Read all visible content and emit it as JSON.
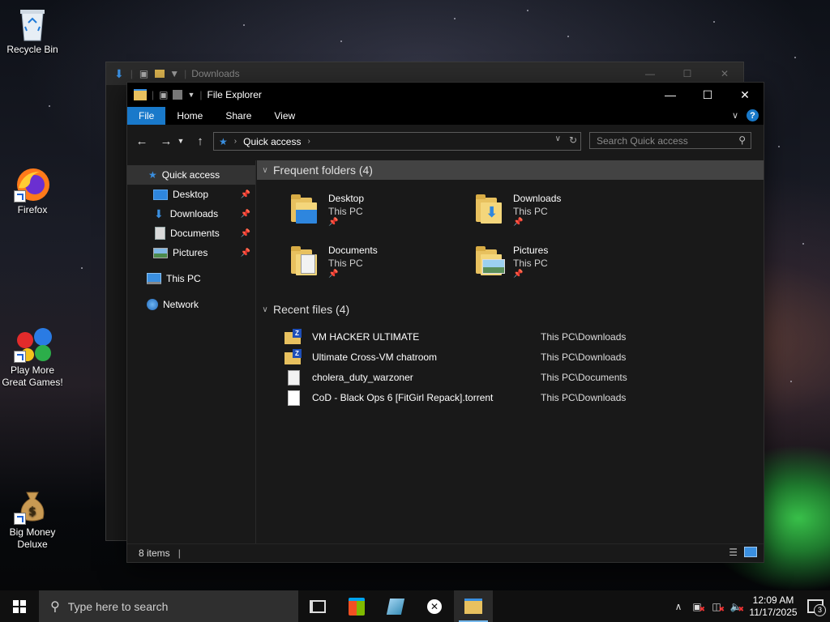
{
  "desktop": {
    "icons": [
      {
        "label": "Recycle Bin"
      },
      {
        "label": "Firefox"
      },
      {
        "label": "Play More Great Games!"
      },
      {
        "label": "Big Money Deluxe"
      }
    ]
  },
  "back_window": {
    "title": "Downloads"
  },
  "window": {
    "title": "File Explorer",
    "ribbon_tabs": [
      "File",
      "Home",
      "Share",
      "View"
    ],
    "address": {
      "crumb": "Quick access"
    },
    "search_placeholder": "Search Quick access",
    "nav": {
      "quick_access": "Quick access",
      "pinned": [
        {
          "label": "Desktop"
        },
        {
          "label": "Downloads"
        },
        {
          "label": "Documents"
        },
        {
          "label": "Pictures"
        }
      ],
      "this_pc": "This PC",
      "network": "Network"
    },
    "frequent": {
      "header": "Frequent folders (4)",
      "items": [
        {
          "name": "Desktop",
          "location": "This PC"
        },
        {
          "name": "Downloads",
          "location": "This PC"
        },
        {
          "name": "Documents",
          "location": "This PC"
        },
        {
          "name": "Pictures",
          "location": "This PC"
        }
      ]
    },
    "recent": {
      "header": "Recent files (4)",
      "items": [
        {
          "name": "VM HACKER ULTIMATE",
          "path": "This PC\\Downloads",
          "icon": "zip-folder-icon"
        },
        {
          "name": "Ultimate Cross-VM chatroom",
          "path": "This PC\\Downloads",
          "icon": "zip-folder-icon"
        },
        {
          "name": "cholera_duty_warzoner",
          "path": "This PC\\Documents",
          "icon": "text-file-icon"
        },
        {
          "name": "CoD - Black Ops 6 [FitGirl Repack].torrent",
          "path": "This PC\\Downloads",
          "icon": "blank-file-icon"
        }
      ]
    },
    "status": "8 items"
  },
  "taskbar": {
    "search_placeholder": "Type here to search",
    "time": "12:09 AM",
    "date": "11/17/2025",
    "notifications": "3"
  },
  "colors": {
    "accent": "#1979ca",
    "folder": "#e8c15f"
  }
}
